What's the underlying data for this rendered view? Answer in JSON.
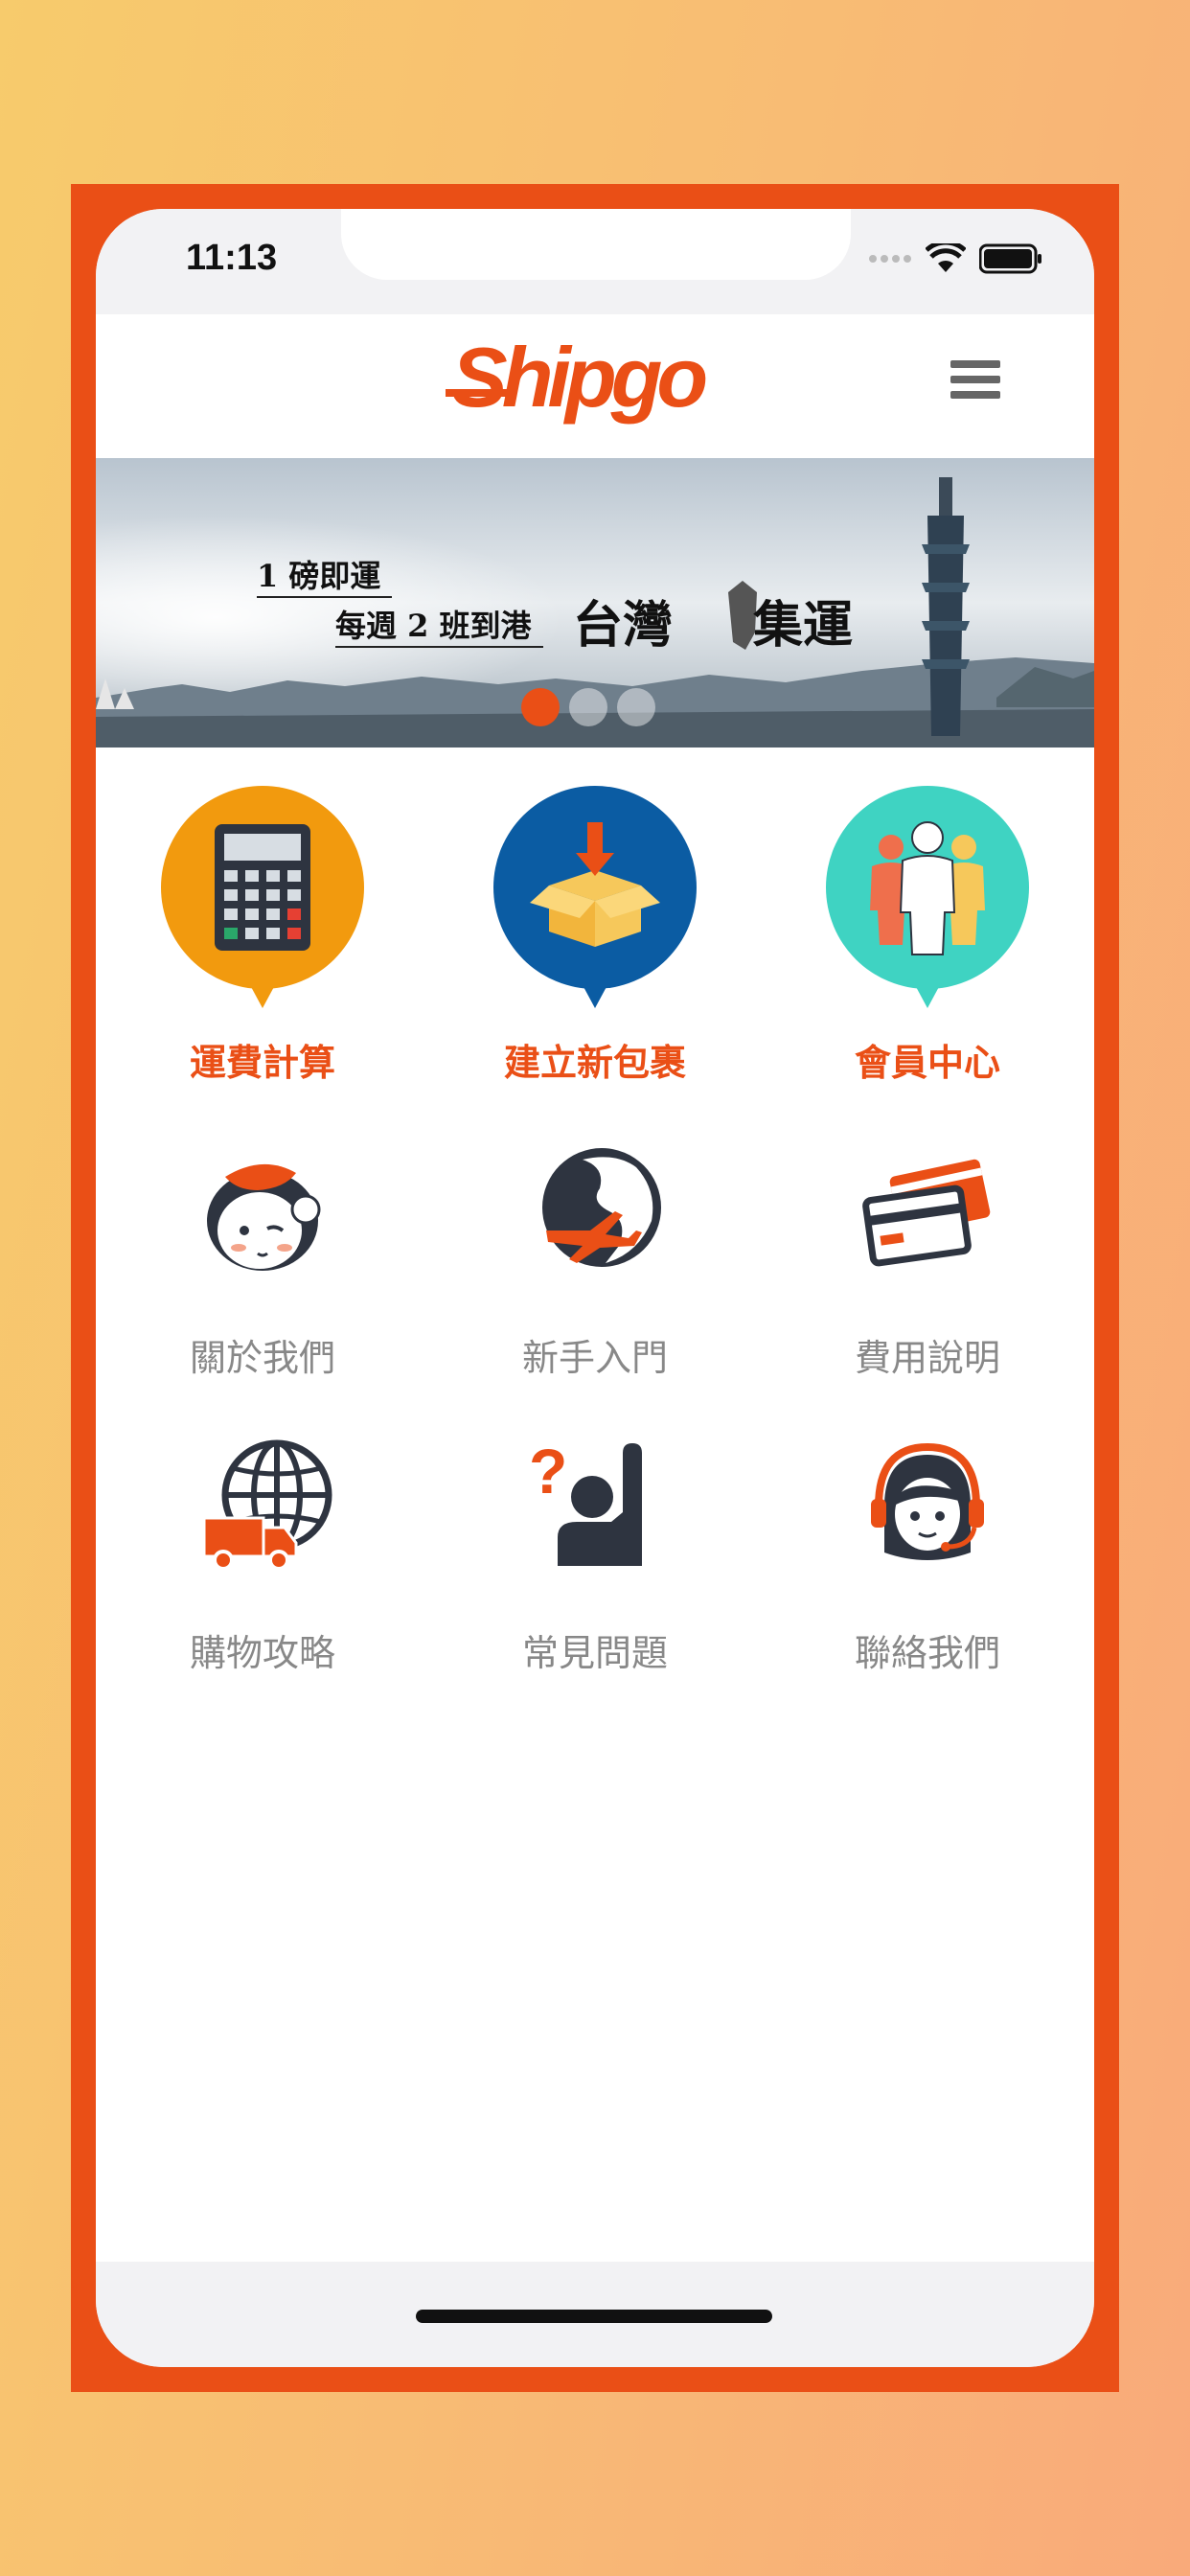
{
  "status_bar": {
    "time": "11:13"
  },
  "header": {
    "logo_text": "Shipgo",
    "menu_icon": "hamburger-menu-icon"
  },
  "banner": {
    "line1": "1 磅即運",
    "line2": "每週 2 班到港",
    "title_left": "台灣",
    "title_right": "集運",
    "slides": 3,
    "active_slide": 1
  },
  "featured": [
    {
      "label": "運費計算",
      "icon": "calculator-icon",
      "color": "#f29a0e"
    },
    {
      "label": "建立新包裹",
      "icon": "package-icon",
      "color": "#0b5ca3"
    },
    {
      "label": "會員中心",
      "icon": "members-icon",
      "color": "#3fd3c2"
    }
  ],
  "menu": [
    {
      "label": "關於我們",
      "icon": "mascot-icon"
    },
    {
      "label": "新手入門",
      "icon": "globe-plane-icon"
    },
    {
      "label": "費用說明",
      "icon": "credit-cards-icon"
    },
    {
      "label": "購物攻略",
      "icon": "globe-truck-icon"
    },
    {
      "label": "常見問題",
      "icon": "question-person-icon"
    },
    {
      "label": "聯絡我們",
      "icon": "customer-service-icon"
    }
  ],
  "colors": {
    "accent": "#ea4f16",
    "label_gray": "#888888",
    "icon_dark": "#333333"
  }
}
